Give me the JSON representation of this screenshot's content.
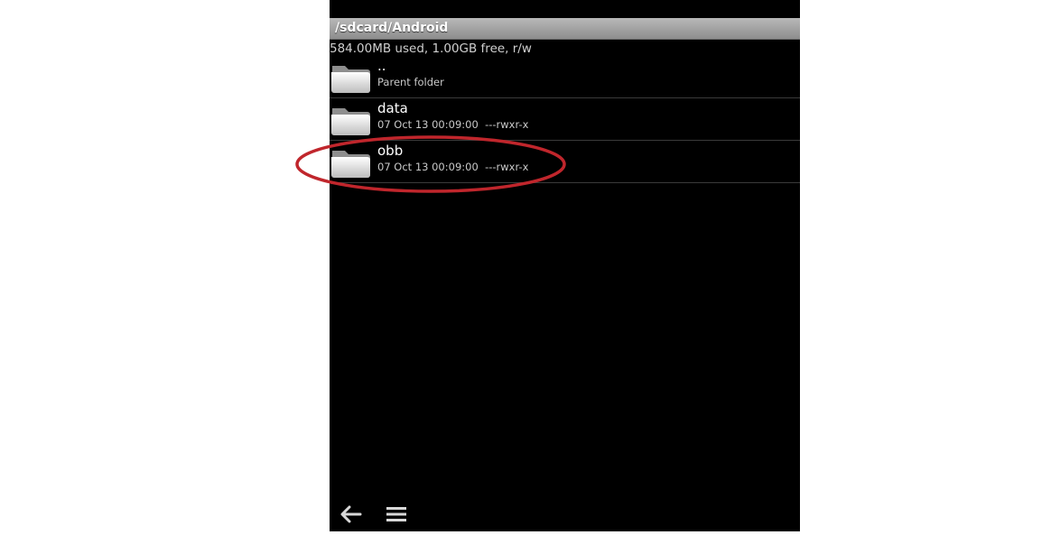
{
  "header": {
    "path": "/sdcard/Android"
  },
  "storage": {
    "summary": "584.00MB used, 1.00GB free, r/w"
  },
  "files": [
    {
      "name": "..",
      "meta": "Parent folder",
      "icon": "folder-icon"
    },
    {
      "name": "data",
      "meta": "07 Oct 13 00:09:00  ---rwxr-x",
      "icon": "folder-icon"
    },
    {
      "name": "obb",
      "meta": "07 Oct 13 00:09:00  ---rwxr-x",
      "icon": "folder-icon"
    }
  ],
  "toolbar": {
    "back_icon": "back-arrow-icon",
    "menu_icon": "menu-icon"
  },
  "colors": {
    "highlight": "#c0262c",
    "background": "#000000",
    "title_bar": "#a3a3a3"
  }
}
